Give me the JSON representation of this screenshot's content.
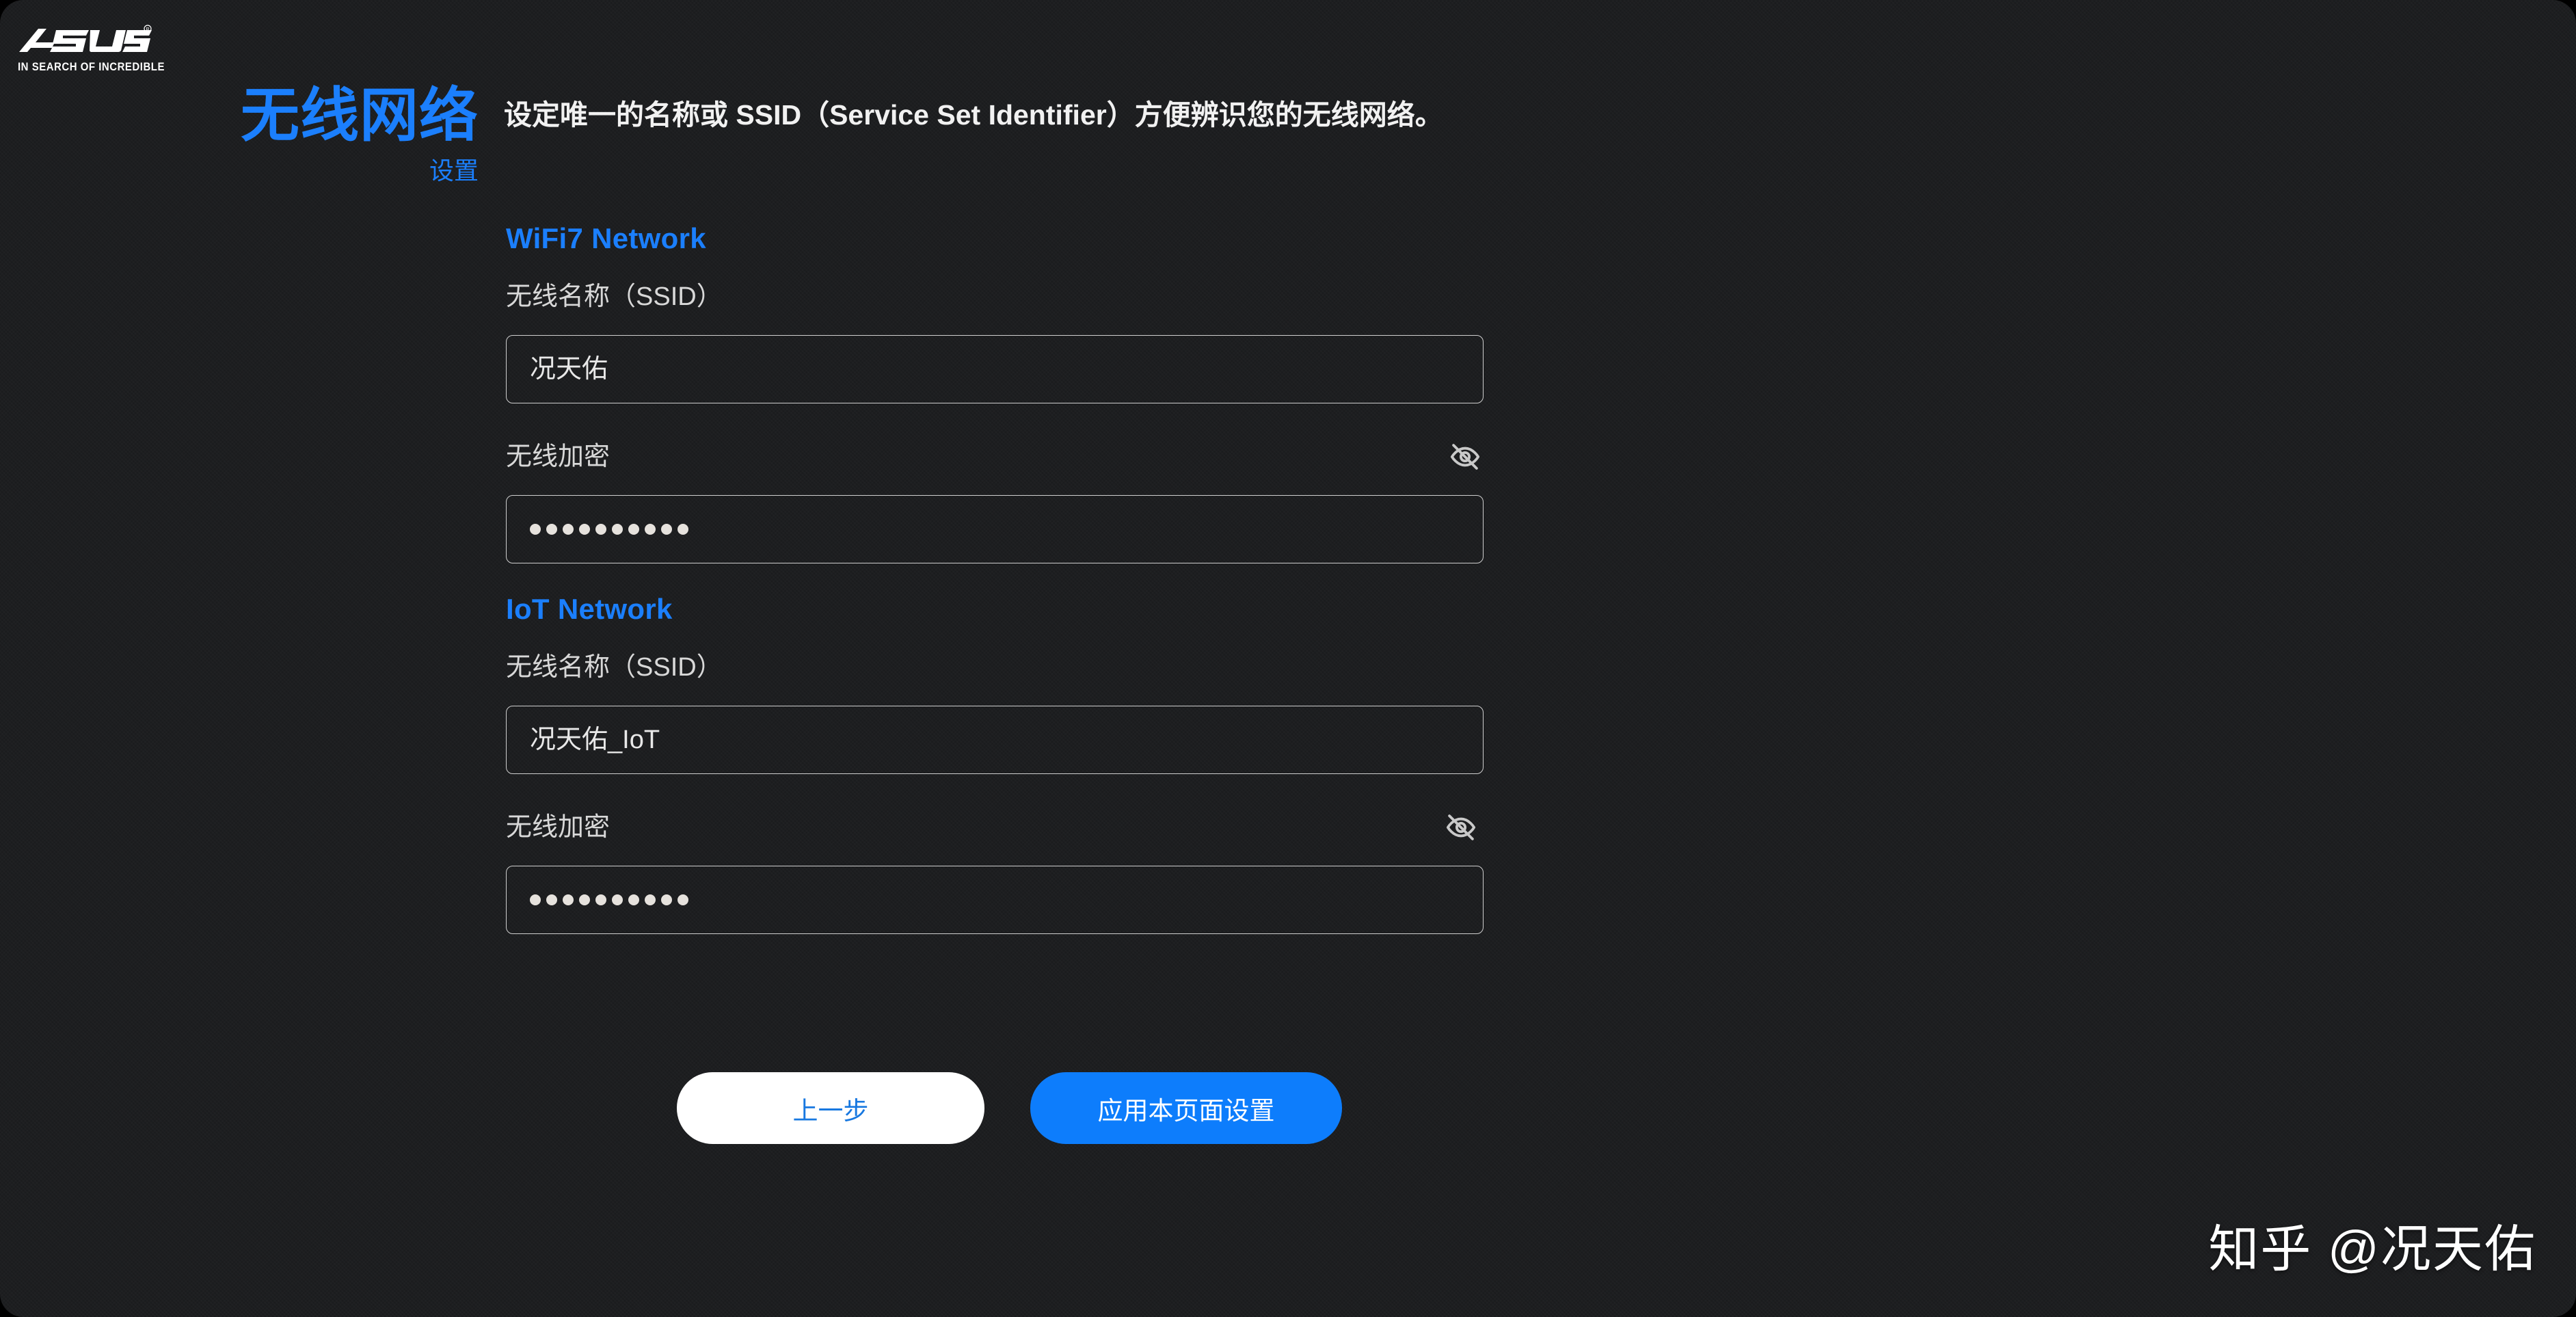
{
  "brand": {
    "name": "ASUS",
    "tagline": "IN SEARCH OF INCREDIBLE",
    "registered_mark": "®"
  },
  "heading": {
    "title": "无线网络",
    "subtitle": "设置",
    "color": "#1b7ffd"
  },
  "description": {
    "text": "设定唯一的名称或 SSID（Service Set Identifier）方便辨识您的无线网络。"
  },
  "sections": [
    {
      "title": "WiFi7 Network",
      "ssid": {
        "label": "无线名称（SSID）",
        "value": "况天佑",
        "placeholder": ""
      },
      "password": {
        "label": "无线加密",
        "masked_value": "••••••••••",
        "dot_count": 10,
        "visible": false,
        "toggle_icon": "eye-off-icon"
      }
    },
    {
      "title": "IoT Network",
      "ssid": {
        "label": "无线名称（SSID）",
        "value": "况天佑_IoT",
        "placeholder": ""
      },
      "password": {
        "label": "无线加密",
        "masked_value": "••••••••••",
        "dot_count": 10,
        "visible": false,
        "toggle_icon": "eye-off-icon"
      }
    }
  ],
  "buttons": {
    "back_label": "上一步",
    "apply_label": "应用本页面设置",
    "back_bg": "#ffffff",
    "back_fg": "#1878e0",
    "apply_bg": "#0d7dfc",
    "apply_fg": "#ffffff"
  },
  "watermark": {
    "text": "知乎 @况天佑"
  },
  "theme": {
    "background": "#1b1c1e",
    "accent": "#1b7ffd",
    "input_border": "#cfcfcf",
    "label_color": "#d8d8d8"
  }
}
